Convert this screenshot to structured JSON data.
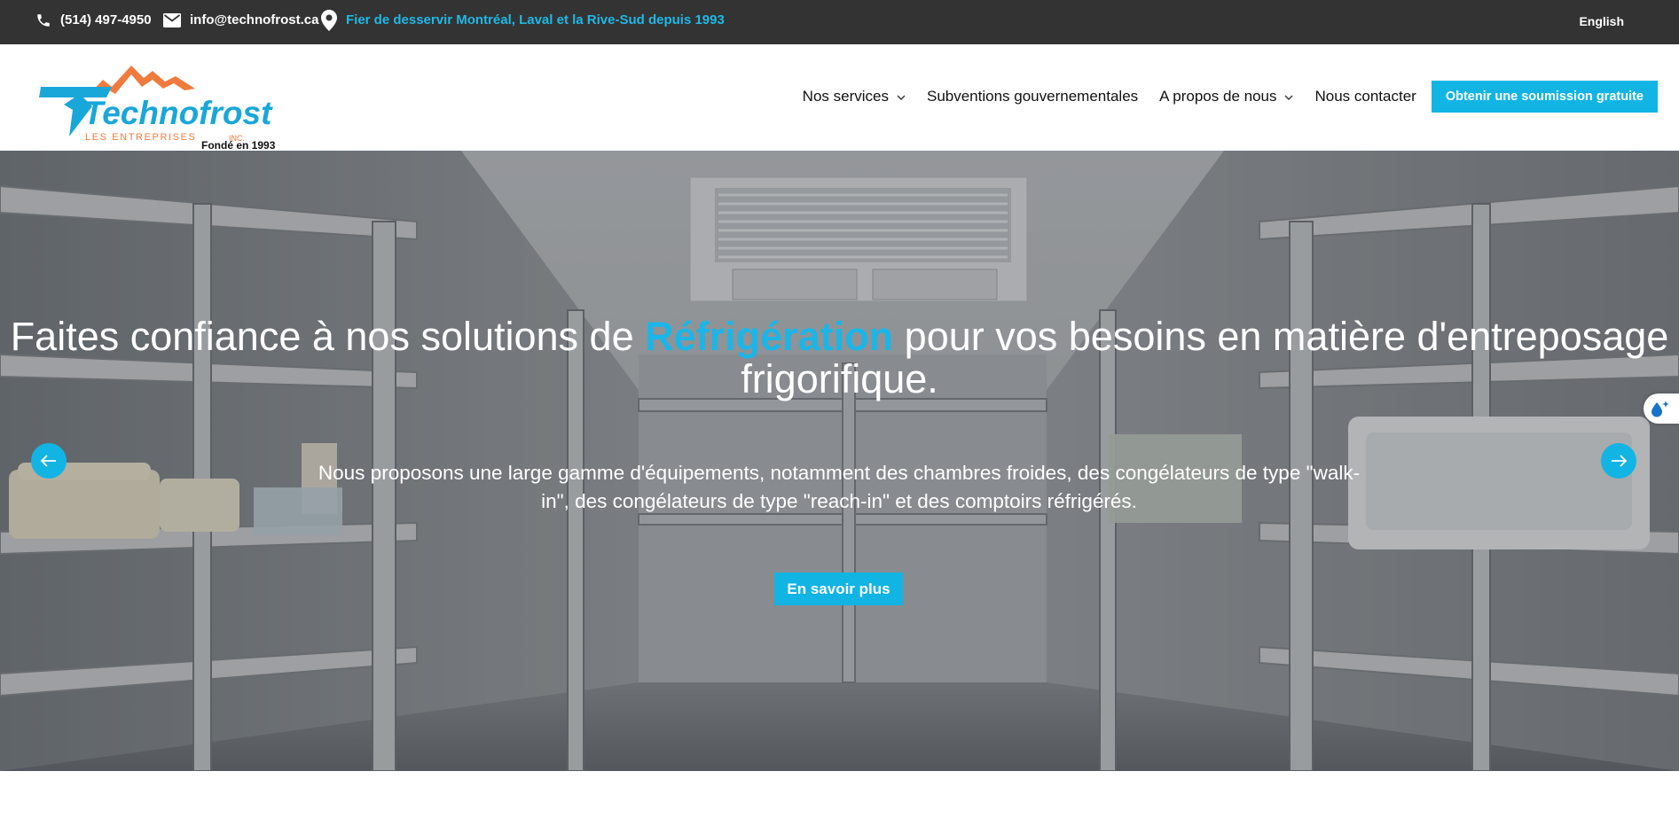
{
  "topbar": {
    "phone": "(514) 497-4950",
    "email": "info@technofrost.ca",
    "tagline": "Fier de desservir Montréal, Laval et la Rive-Sud depuis 1993",
    "language": "English",
    "icons": [
      "phone-icon",
      "mail-icon",
      "location-pin-icon"
    ]
  },
  "logo": {
    "wordmark": "Technofrost",
    "line2": "LES ENTREPRISES",
    "suffix": "INC.",
    "founded": "Fondé en 1993"
  },
  "nav": {
    "items": [
      {
        "label": "Nos services",
        "dropdown": true
      },
      {
        "label": "Subventions gouvernementales",
        "dropdown": false
      },
      {
        "label": "A propos de nous",
        "dropdown": true
      },
      {
        "label": "Nous contacter",
        "dropdown": false
      }
    ],
    "cta": "Obtenir une soumission gratuite"
  },
  "hero": {
    "title_before": "Faites confiance à nos solutions de ",
    "title_highlight": "Réfrigération",
    "title_after": " pour vos besoins en matière d'entreposage frigorifique.",
    "subtitle": "Nous proposons une large gamme d'équipements, notamment des chambres froides, des congélateurs de type \"walk-in\", des congélateurs de type \"reach-in\" et des comptoirs réfrigérés.",
    "button": "En savoir plus"
  },
  "colors": {
    "accent": "#12b4e4",
    "topbar_bg": "#333333",
    "tagline": "#20b8e6",
    "logo_blue": "#19a7d9",
    "logo_orange": "#f07b3f"
  }
}
